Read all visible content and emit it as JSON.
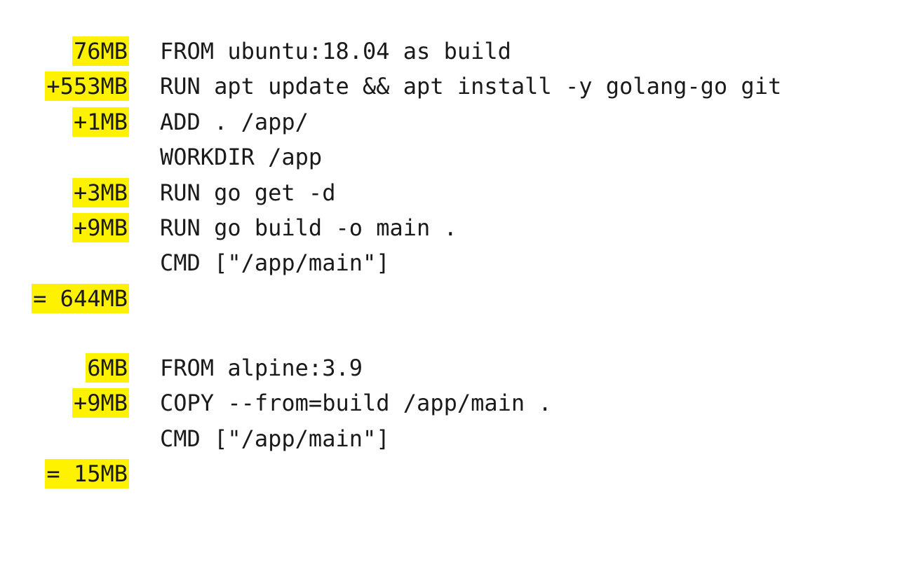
{
  "highlight_color": "#fef200",
  "text_color": "#1a1a1a",
  "builds": [
    {
      "lines": [
        {
          "size": "76MB",
          "cmd": "FROM ubuntu:18.04 as build"
        },
        {
          "size": "+553MB",
          "cmd": "RUN apt update && apt install -y golang-go git"
        },
        {
          "size": "+1MB",
          "cmd": "ADD . /app/"
        },
        {
          "size": "",
          "cmd": "WORKDIR /app"
        },
        {
          "size": "+3MB",
          "cmd": "RUN go get -d"
        },
        {
          "size": "+9MB",
          "cmd": "RUN go build -o main ."
        },
        {
          "size": "",
          "cmd": "CMD [\"/app/main\"]"
        }
      ],
      "total": "= 644MB"
    },
    {
      "lines": [
        {
          "size": "6MB",
          "cmd": "FROM alpine:3.9"
        },
        {
          "size": "+9MB",
          "cmd": "COPY --from=build /app/main ."
        },
        {
          "size": "",
          "cmd": "CMD [\"/app/main\"]"
        }
      ],
      "total": "= 15MB"
    }
  ]
}
